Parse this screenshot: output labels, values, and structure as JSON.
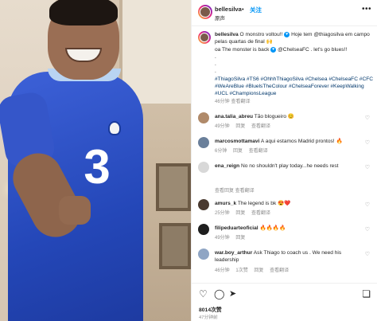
{
  "header": {
    "username": "bellesilva",
    "separator": "•",
    "follow_label": "关注",
    "subtitle": "原声"
  },
  "caption": {
    "username": "bellesilva",
    "line1": "O monstro voltou!!",
    "line1b": "Hoje tem @thiagosilva em campo pelas quartas de final",
    "line2": "oa The monster is back",
    "line2b": "@ChelseaFC . let's go blues!!",
    "dots": [
      ".",
      ".",
      "."
    ],
    "hashtags": "#ThiagoSilva #TS6 #OhhhThiagoSilva #Chelsea #ChelseaFC #CFC #WeAreBlue #BluelsTheColour #ChelseaForever #KeepWalking #UCL #ChampionsLeague",
    "age": "46分钟",
    "translate": "查看翻译"
  },
  "comments": [
    {
      "username": "ana.talia_abreu",
      "text": "Tão blogueiro",
      "age": "49分钟",
      "likes": "",
      "reply": "回复",
      "translate": "查看翻译",
      "avatar_color": "#b08a6a"
    },
    {
      "username": "marcosmottamavi",
      "text": "A aqui estamos Madrid prontos!",
      "age": "6分钟",
      "likes": "",
      "reply": "回复",
      "translate": "查看翻译",
      "avatar_color": "#6a7f9a"
    },
    {
      "username": "ena_reign",
      "text": "No no shouldn't play today...he needs rest",
      "age": "",
      "likes": "",
      "reply": "",
      "translate": "查看回复 查看翻译",
      "avatar_color": "#d8d8d8"
    },
    {
      "username": "amurs_k",
      "text": "The legend is bk",
      "age": "25分钟",
      "likes": "",
      "reply": "回复",
      "translate": "查看翻译",
      "avatar_color": "#4a3a30"
    },
    {
      "username": "filipeduarteoficial",
      "text": "",
      "age": "49分钟",
      "likes": "",
      "reply": "回复",
      "translate": "",
      "avatar_color": "#1e1e1e"
    },
    {
      "username": "war.boy_arthur",
      "text": "Ask Thiago to coach us . We need his leadership",
      "age": "46分钟",
      "likes": "1次赞",
      "reply": "回复",
      "translate": "查看翻译",
      "avatar_color": "#8fa5c4"
    }
  ],
  "actions": {
    "like_icon": "heart-icon",
    "comment_icon": "comment-icon",
    "share_icon": "share-icon",
    "save_icon": "bookmark-icon",
    "likes": "8014次赞",
    "time": "47分钟前"
  },
  "colors": {
    "link": "#00376b",
    "follow": "#0095f6",
    "muted": "#8e8e8e",
    "shirt": "#2447b8"
  }
}
